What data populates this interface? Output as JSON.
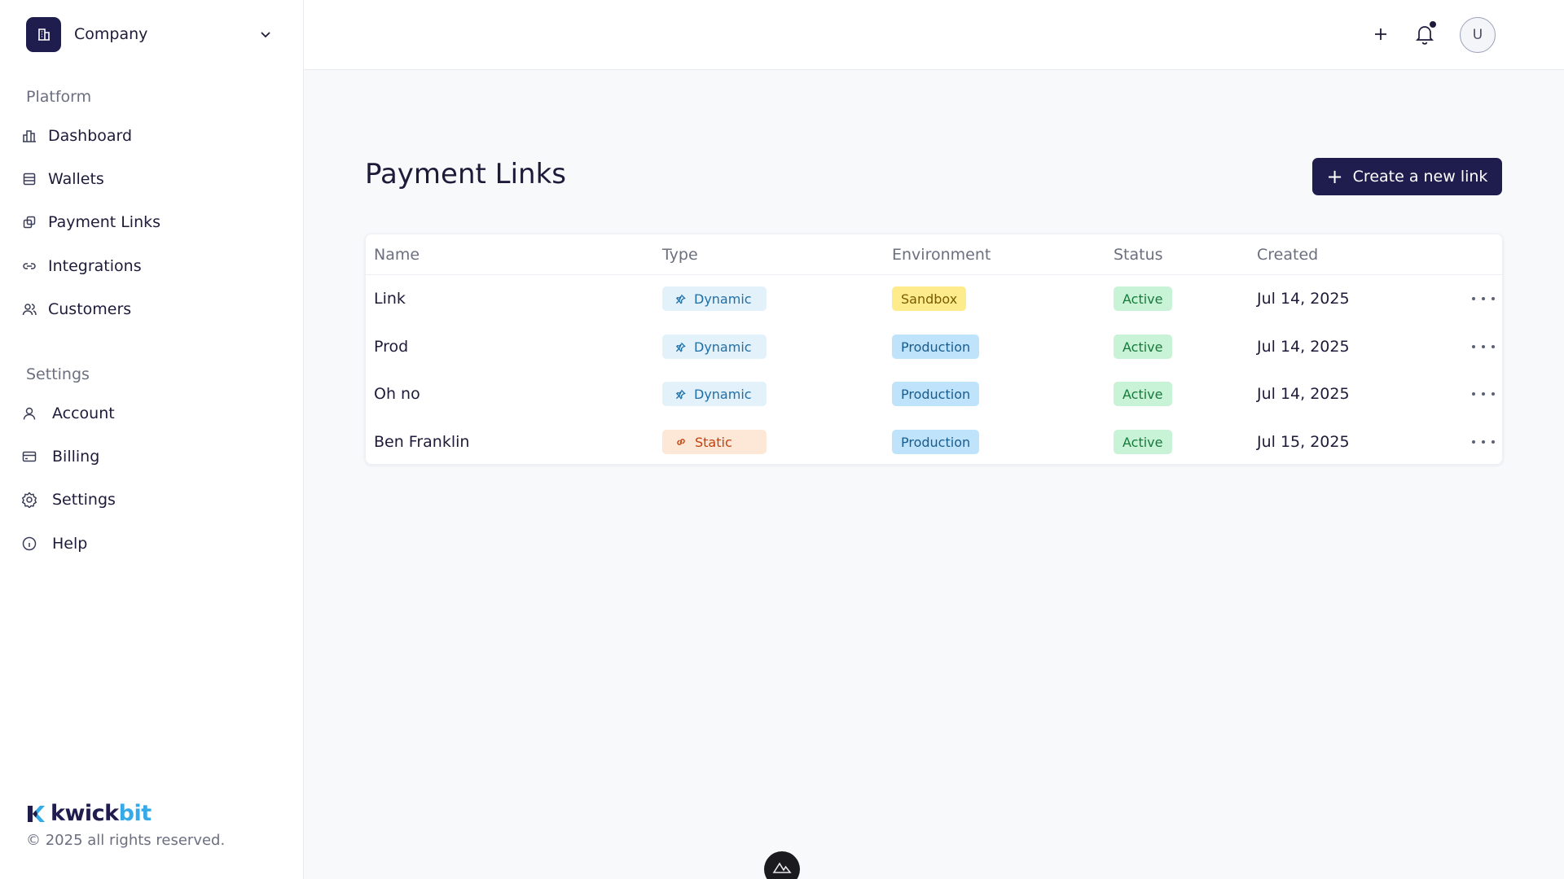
{
  "sidebar": {
    "company_name": "Company",
    "platform_label": "Platform",
    "platform_items": [
      {
        "label": "Dashboard",
        "icon": "chart-bar-icon"
      },
      {
        "label": "Wallets",
        "icon": "wallet-icon"
      },
      {
        "label": "Payment Links",
        "icon": "copy-link-icon"
      },
      {
        "label": "Integrations",
        "icon": "link-icon"
      },
      {
        "label": "Customers",
        "icon": "users-icon"
      }
    ],
    "settings_label": "Settings",
    "settings_items": [
      {
        "label": "Account",
        "icon": "user-icon"
      },
      {
        "label": "Billing",
        "icon": "credit-card-icon"
      },
      {
        "label": "Settings",
        "icon": "gear-icon"
      },
      {
        "label": "Help",
        "icon": "info-icon"
      }
    ],
    "brand": {
      "part1": "kwick",
      "part2": "bit"
    },
    "copyright": "© 2025 all rights reserved."
  },
  "topbar": {
    "avatar_initial": "U",
    "has_notification": true
  },
  "main": {
    "title": "Payment Links",
    "create_button": "Create a new link",
    "table": {
      "headers": [
        "Name",
        "Type",
        "Environment",
        "Status",
        "Created"
      ],
      "rows": [
        {
          "name": "Link",
          "type": "Dynamic",
          "environment": "Sandbox",
          "status": "Active",
          "created": "Jul 14, 2025"
        },
        {
          "name": "Prod",
          "type": "Dynamic",
          "environment": "Production",
          "status": "Active",
          "created": "Jul 14, 2025"
        },
        {
          "name": "Oh no",
          "type": "Dynamic",
          "environment": "Production",
          "status": "Active",
          "created": "Jul 14, 2025"
        },
        {
          "name": "Ben Franklin",
          "type": "Static",
          "environment": "Production",
          "status": "Active",
          "created": "Jul 15, 2025"
        }
      ]
    }
  },
  "colors": {
    "primary": "#1f1d4d",
    "brand_accent": "#36a9e8",
    "dynamic_bg": "#e3f1fb",
    "dynamic_fg": "#1f6fa6",
    "static_bg": "#fde7d6",
    "static_fg": "#c2410c",
    "sandbox_bg": "#fdeb8c",
    "sandbox_fg": "#7a5b00",
    "production_bg": "#bfe3fb",
    "production_fg": "#185d8f",
    "active_bg": "#c9f3d6",
    "active_fg": "#167a3c"
  }
}
